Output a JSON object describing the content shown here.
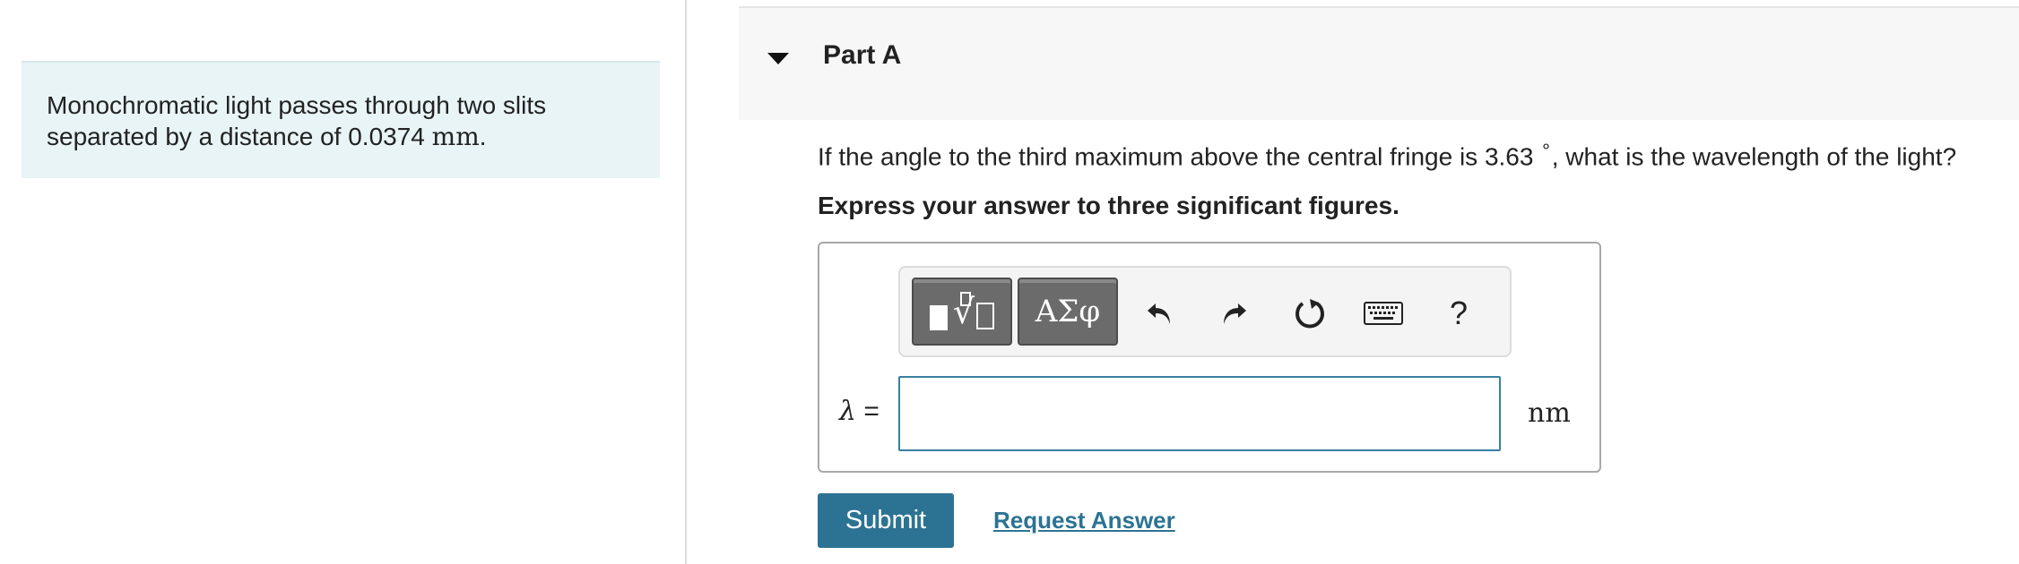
{
  "intro": {
    "text": "Monochromatic light passes through two slits separated by a distance of 0.0374",
    "unit": "mm",
    "period": "."
  },
  "part": {
    "title": "Part A"
  },
  "question": {
    "text_before": "If the angle to the third maximum above the central fringe is 3.63",
    "degree": "∘",
    "text_after": ", what is the wavelength of the light?"
  },
  "instruction": "Express your answer to three significant figures.",
  "toolbar": {
    "templates_label": "templates",
    "symbols_label": "ΑΣφ",
    "undo_icon": "undo-icon",
    "redo_icon": "redo-icon",
    "reset_icon": "reset-icon",
    "keyboard_icon": "keyboard-icon",
    "help_label": "?"
  },
  "answer": {
    "variable": "λ",
    "equals": "=",
    "value": "",
    "unit": "nm"
  },
  "actions": {
    "submit_label": "Submit",
    "request_label": "Request Answer"
  },
  "colors": {
    "accent": "#2c7393",
    "intro_bg": "#e8f4f6",
    "header_bg": "#f7f7f7",
    "tool_btn": "#6b6b6b"
  }
}
